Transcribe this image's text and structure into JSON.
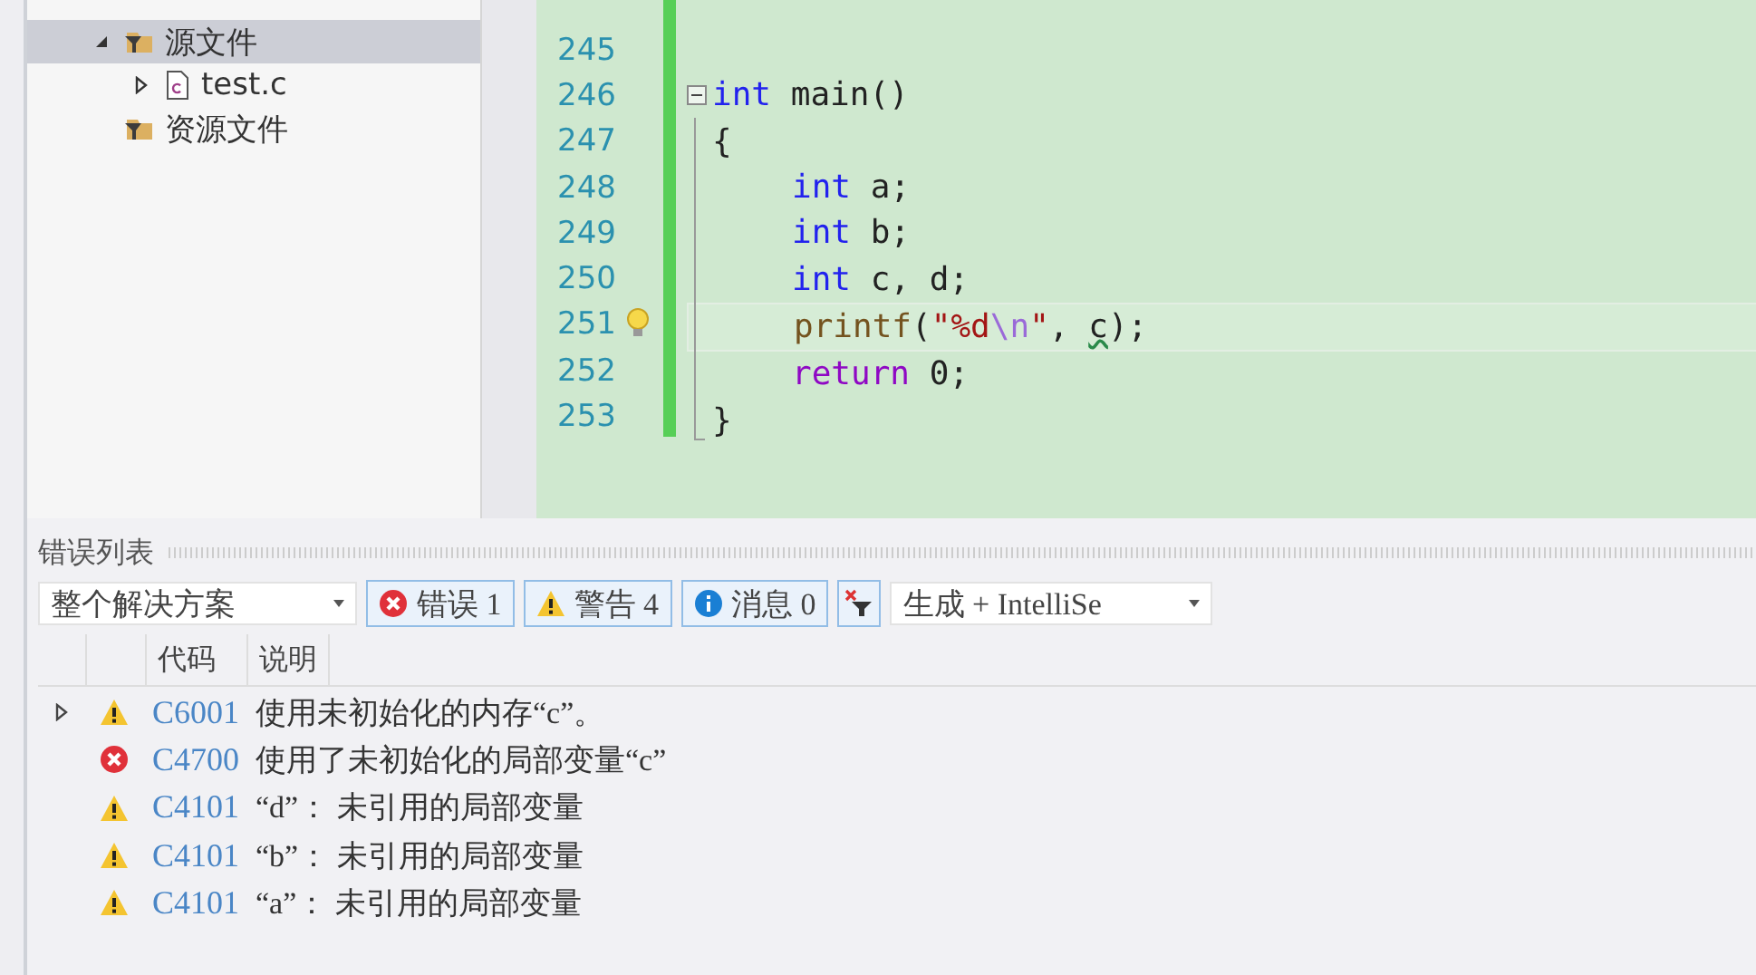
{
  "solution_tree": {
    "items": [
      {
        "label": "源文件",
        "kind": "filter",
        "selected": true,
        "expanded": true,
        "children": [
          {
            "label": "test.c",
            "kind": "file",
            "selected": false,
            "expanded": false
          }
        ]
      },
      {
        "label": "资源文件",
        "kind": "filter",
        "selected": false
      }
    ]
  },
  "editor": {
    "lines": [
      {
        "number": "245"
      },
      {
        "number": "246",
        "fold": true,
        "segments": [
          {
            "text": "int",
            "kind": "keyword"
          },
          {
            "text": " main()",
            "kind": "plain"
          }
        ]
      },
      {
        "number": "247",
        "segments": [
          {
            "text": "{",
            "kind": "plain"
          }
        ]
      },
      {
        "number": "248",
        "indented": true,
        "segments": [
          {
            "text": "int",
            "kind": "keyword"
          },
          {
            "text": " a;",
            "kind": "plain"
          }
        ]
      },
      {
        "number": "249",
        "indented": true,
        "segments": [
          {
            "text": "int",
            "kind": "keyword"
          },
          {
            "text": " b;",
            "kind": "plain"
          }
        ]
      },
      {
        "number": "250",
        "indented": true,
        "segments": [
          {
            "text": "int",
            "kind": "keyword"
          },
          {
            "text": " c, d;",
            "kind": "plain"
          }
        ]
      },
      {
        "number": "251",
        "indented": true,
        "hint": true,
        "current": true,
        "segments": [
          {
            "text": "printf",
            "kind": "function"
          },
          {
            "text": "(",
            "kind": "plain"
          },
          {
            "text": "\"%d",
            "kind": "string"
          },
          {
            "text": "\\n",
            "kind": "escape"
          },
          {
            "text": "\"",
            "kind": "string"
          },
          {
            "text": ", ",
            "kind": "plain"
          },
          {
            "text": "c",
            "kind": "squiggle"
          },
          {
            "text": ");",
            "kind": "plain"
          }
        ]
      },
      {
        "number": "252",
        "indented": true,
        "segments": [
          {
            "text": "return",
            "kind": "control"
          },
          {
            "text": " 0;",
            "kind": "plain"
          }
        ]
      },
      {
        "number": "253",
        "segments": [
          {
            "text": "}",
            "kind": "plain"
          }
        ]
      }
    ]
  },
  "error_list": {
    "title": "错误列表",
    "scope": "整个解决方案",
    "filters": [
      {
        "kind": "error",
        "label": "错误 1",
        "selected": true
      },
      {
        "kind": "warning",
        "label": "警告 4",
        "selected": true
      },
      {
        "kind": "info",
        "label": "消息 0",
        "selected": true
      }
    ],
    "source": "生成 + IntelliSe",
    "columns": [
      "代码",
      "说明"
    ],
    "rows": [
      {
        "kind": "warning",
        "expanded": false,
        "code": "C6001",
        "description": "使用未初始化的内存“c”。"
      },
      {
        "kind": "error",
        "code": "C4700",
        "description": "使用了未初始化的局部变量“c”"
      },
      {
        "kind": "warning",
        "code": "C4101",
        "description": "“d”： 未引用的局部变量"
      },
      {
        "kind": "warning",
        "code": "C4101",
        "description": "“b”： 未引用的局部变量"
      },
      {
        "kind": "warning",
        "code": "C4101",
        "description": "“a”： 未引用的局部变量"
      }
    ]
  }
}
